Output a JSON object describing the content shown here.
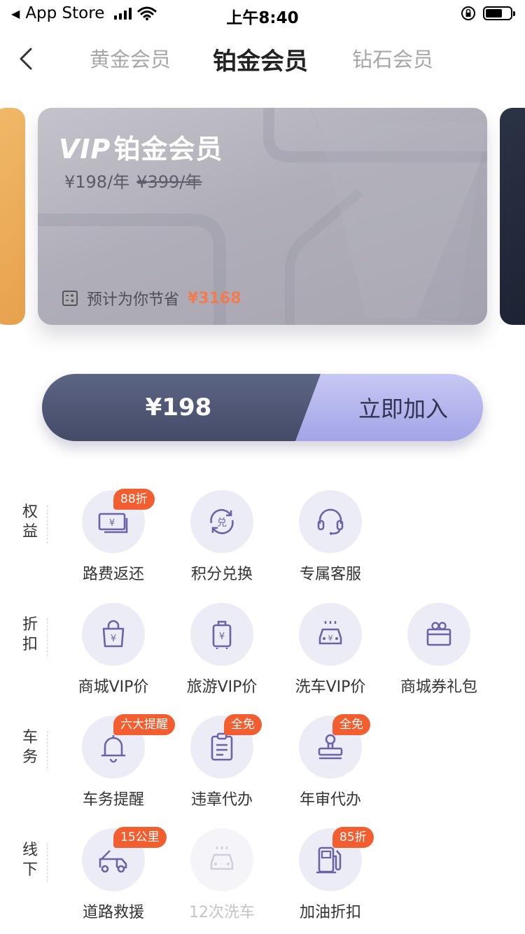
{
  "status_bar": {
    "carrier": "App Store",
    "time": "上午8:40",
    "back_arrow": "◀"
  },
  "nav": {
    "tabs": [
      "黄金会员",
      "铂金会员",
      "钻石会员"
    ],
    "active_tab": 1
  },
  "card": {
    "vip_mark": "VIP",
    "title": "铂金会员",
    "price": "¥198/年",
    "original_price": "¥399/年",
    "save_text": "预计为你节省",
    "save_amount": "¥3168"
  },
  "join": {
    "price": "¥198",
    "button": "立即加入"
  },
  "sections": [
    {
      "category": [
        "权",
        "益"
      ],
      "items": [
        {
          "label": "路费返还",
          "badge": "88折",
          "icon": "cash-icon"
        },
        {
          "label": "积分兑换",
          "badge": "",
          "icon": "exchange-icon"
        },
        {
          "label": "专属客服",
          "badge": "",
          "icon": "headset-icon"
        }
      ]
    },
    {
      "category": [
        "折",
        "扣"
      ],
      "items": [
        {
          "label": "商城VIP价",
          "badge": "",
          "icon": "shopping-bag-icon"
        },
        {
          "label": "旅游VIP价",
          "badge": "",
          "icon": "luggage-icon"
        },
        {
          "label": "洗车VIP价",
          "badge": "",
          "icon": "car-wash-icon"
        },
        {
          "label": "商城券礼包",
          "badge": "",
          "icon": "gift-icon"
        }
      ]
    },
    {
      "category": [
        "车",
        "务"
      ],
      "items": [
        {
          "label": "车务提醒",
          "badge": "六大提醒",
          "icon": "bell-icon"
        },
        {
          "label": "违章代办",
          "badge": "全免",
          "icon": "clipboard-icon"
        },
        {
          "label": "年审代办",
          "badge": "全免",
          "icon": "stamp-icon"
        }
      ]
    },
    {
      "category": [
        "线",
        "下"
      ],
      "items": [
        {
          "label": "道路救援",
          "badge": "15公里",
          "icon": "tow-truck-icon"
        },
        {
          "label": "12次洗车",
          "badge": "",
          "icon": "car-wash-dim-icon",
          "disabled": true
        },
        {
          "label": "加油折扣",
          "badge": "85折",
          "icon": "fuel-pump-icon"
        }
      ]
    }
  ],
  "colors": {
    "accent": "#f25e2f",
    "icon": "#6b63a8",
    "join_dark": "#4d5573",
    "join_light": "#a9abe9"
  }
}
